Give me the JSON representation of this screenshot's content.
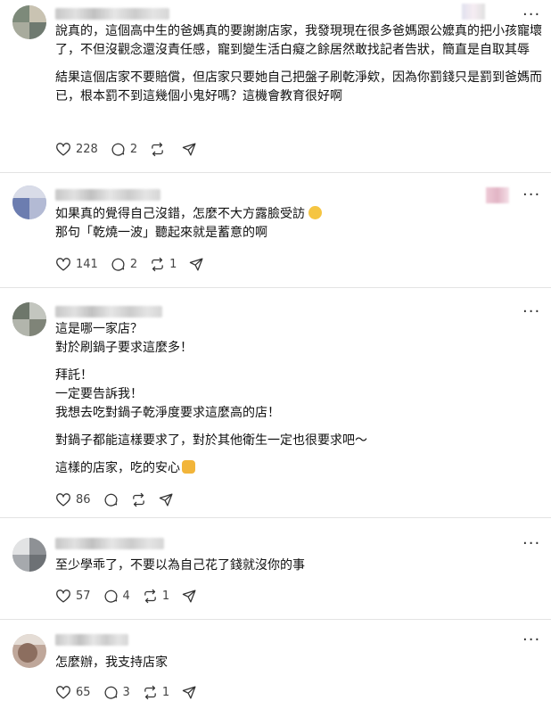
{
  "posts": [
    {
      "paragraphs": [
        "說真的，這個高中生的爸媽真的要謝謝店家，我發現現在很多爸媽跟公嬤真的把小孩寵壞了，不但沒觀念還沒責任感，寵到變生活白癡之餘居然敢找記者告狀，簡直是自取其辱",
        "結果這個店家不要賠償，但店家只要她自己把盤子刷乾淨欸，因為你罰錢只是罰到爸媽而已，根本罰不到這幾個小鬼好嗎？這機會教育很好啊"
      ],
      "likes": "228",
      "replies": "2",
      "reposts": ""
    },
    {
      "paragraphs": [
        "如果真的覺得自己沒錯，怎麼不大方露臉受訪",
        "那句「乾燒一波」聽起來就是蓄意的啊"
      ],
      "likes": "141",
      "replies": "2",
      "reposts": "1"
    },
    {
      "paragraphs": [
        "這是哪一家店？\n對於刷鍋子要求這麼多！",
        "拜託！\n一定要告訴我！\n我想去吃對鍋子乾淨度要求這麼高的店！",
        "對鍋子都能這樣要求了，對於其他衛生一定也很要求吧～",
        "這樣的店家，吃的安心"
      ],
      "likes": "86",
      "replies": "",
      "reposts": ""
    },
    {
      "paragraphs": [
        "至少學乖了，不要以為自己花了錢就沒你的事"
      ],
      "likes": "57",
      "replies": "4",
      "reposts": "1"
    },
    {
      "paragraphs": [
        "怎麼辦，我支持店家"
      ],
      "likes": "65",
      "replies": "3",
      "reposts": "1"
    }
  ],
  "icons": {
    "like": "heart-icon",
    "reply": "comment-icon",
    "repost": "repost-icon",
    "share": "share-icon",
    "more": "more-icon"
  },
  "more_glyph": "···"
}
